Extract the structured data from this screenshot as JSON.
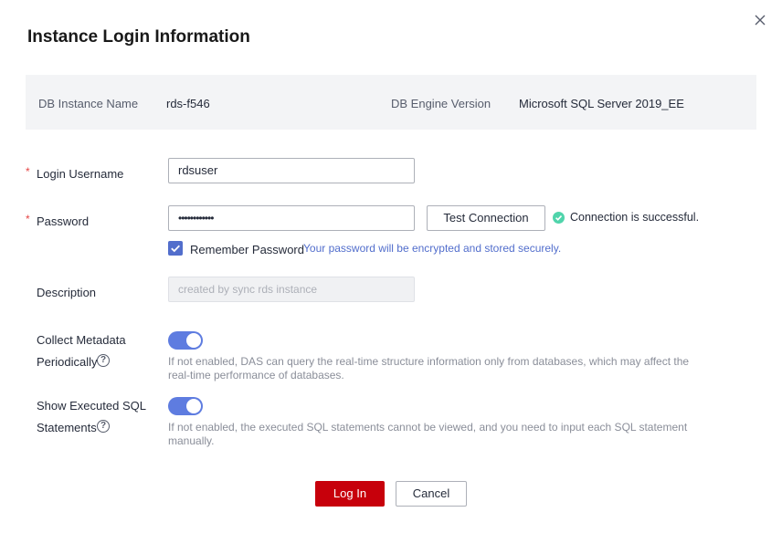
{
  "dialog": {
    "title": "Instance Login Information"
  },
  "info": {
    "instance_name_label": "DB Instance Name",
    "instance_name_value": "rds-f546",
    "engine_version_label": "DB Engine Version",
    "engine_version_value": "Microsoft SQL Server 2019_EE"
  },
  "form": {
    "required_mark": "*",
    "username_label": "Login Username",
    "username_value": "rdsuser",
    "password_label": "Password",
    "password_value": "••••••••••••",
    "test_connection_label": "Test Connection",
    "connection_status": "Connection is successful.",
    "remember_label": "Remember Password",
    "remember_checked": true,
    "remember_note": "Your password will be encrypted and stored securely.",
    "description_label": "Description",
    "description_placeholder": "created by sync rds instance",
    "metadata_label_line1": "Collect Metadata",
    "metadata_label_line2": "Periodically",
    "metadata_enabled": true,
    "metadata_hint_line1": "If not enabled, DAS can query the real-time structure information only from databases, which may affect the",
    "metadata_hint_line2": "real-time performance of databases.",
    "sql_label_line1": "Show Executed SQL",
    "sql_label_line2": "Statements",
    "sql_enabled": true,
    "sql_hint_line1": "If not enabled, the executed SQL statements cannot be viewed, and you need to input each SQL statement",
    "sql_hint_line2": "manually.",
    "help_glyph": "?"
  },
  "footer": {
    "login_label": "Log In",
    "cancel_label": "Cancel"
  },
  "colors": {
    "primary_button": "#c7000b",
    "toggle_on": "#5e7ce0",
    "checkbox": "#526ecc",
    "success": "#50d4ab",
    "required": "#e54545"
  },
  "icons": [
    "close-icon",
    "check-icon",
    "success-icon",
    "help-icon"
  ]
}
